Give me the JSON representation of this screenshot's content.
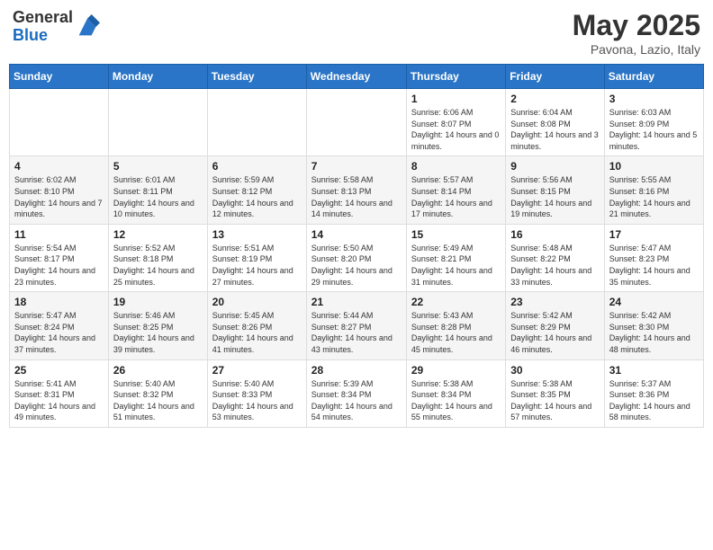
{
  "logo": {
    "general": "General",
    "blue": "Blue"
  },
  "header": {
    "month_title": "May 2025",
    "location": "Pavona, Lazio, Italy"
  },
  "weekdays": [
    "Sunday",
    "Monday",
    "Tuesday",
    "Wednesday",
    "Thursday",
    "Friday",
    "Saturday"
  ],
  "weeks": [
    [
      {
        "day": "",
        "info": ""
      },
      {
        "day": "",
        "info": ""
      },
      {
        "day": "",
        "info": ""
      },
      {
        "day": "",
        "info": ""
      },
      {
        "day": "1",
        "info": "Sunrise: 6:06 AM\nSunset: 8:07 PM\nDaylight: 14 hours and 0 minutes."
      },
      {
        "day": "2",
        "info": "Sunrise: 6:04 AM\nSunset: 8:08 PM\nDaylight: 14 hours and 3 minutes."
      },
      {
        "day": "3",
        "info": "Sunrise: 6:03 AM\nSunset: 8:09 PM\nDaylight: 14 hours and 5 minutes."
      }
    ],
    [
      {
        "day": "4",
        "info": "Sunrise: 6:02 AM\nSunset: 8:10 PM\nDaylight: 14 hours and 7 minutes."
      },
      {
        "day": "5",
        "info": "Sunrise: 6:01 AM\nSunset: 8:11 PM\nDaylight: 14 hours and 10 minutes."
      },
      {
        "day": "6",
        "info": "Sunrise: 5:59 AM\nSunset: 8:12 PM\nDaylight: 14 hours and 12 minutes."
      },
      {
        "day": "7",
        "info": "Sunrise: 5:58 AM\nSunset: 8:13 PM\nDaylight: 14 hours and 14 minutes."
      },
      {
        "day": "8",
        "info": "Sunrise: 5:57 AM\nSunset: 8:14 PM\nDaylight: 14 hours and 17 minutes."
      },
      {
        "day": "9",
        "info": "Sunrise: 5:56 AM\nSunset: 8:15 PM\nDaylight: 14 hours and 19 minutes."
      },
      {
        "day": "10",
        "info": "Sunrise: 5:55 AM\nSunset: 8:16 PM\nDaylight: 14 hours and 21 minutes."
      }
    ],
    [
      {
        "day": "11",
        "info": "Sunrise: 5:54 AM\nSunset: 8:17 PM\nDaylight: 14 hours and 23 minutes."
      },
      {
        "day": "12",
        "info": "Sunrise: 5:52 AM\nSunset: 8:18 PM\nDaylight: 14 hours and 25 minutes."
      },
      {
        "day": "13",
        "info": "Sunrise: 5:51 AM\nSunset: 8:19 PM\nDaylight: 14 hours and 27 minutes."
      },
      {
        "day": "14",
        "info": "Sunrise: 5:50 AM\nSunset: 8:20 PM\nDaylight: 14 hours and 29 minutes."
      },
      {
        "day": "15",
        "info": "Sunrise: 5:49 AM\nSunset: 8:21 PM\nDaylight: 14 hours and 31 minutes."
      },
      {
        "day": "16",
        "info": "Sunrise: 5:48 AM\nSunset: 8:22 PM\nDaylight: 14 hours and 33 minutes."
      },
      {
        "day": "17",
        "info": "Sunrise: 5:47 AM\nSunset: 8:23 PM\nDaylight: 14 hours and 35 minutes."
      }
    ],
    [
      {
        "day": "18",
        "info": "Sunrise: 5:47 AM\nSunset: 8:24 PM\nDaylight: 14 hours and 37 minutes."
      },
      {
        "day": "19",
        "info": "Sunrise: 5:46 AM\nSunset: 8:25 PM\nDaylight: 14 hours and 39 minutes."
      },
      {
        "day": "20",
        "info": "Sunrise: 5:45 AM\nSunset: 8:26 PM\nDaylight: 14 hours and 41 minutes."
      },
      {
        "day": "21",
        "info": "Sunrise: 5:44 AM\nSunset: 8:27 PM\nDaylight: 14 hours and 43 minutes."
      },
      {
        "day": "22",
        "info": "Sunrise: 5:43 AM\nSunset: 8:28 PM\nDaylight: 14 hours and 45 minutes."
      },
      {
        "day": "23",
        "info": "Sunrise: 5:42 AM\nSunset: 8:29 PM\nDaylight: 14 hours and 46 minutes."
      },
      {
        "day": "24",
        "info": "Sunrise: 5:42 AM\nSunset: 8:30 PM\nDaylight: 14 hours and 48 minutes."
      }
    ],
    [
      {
        "day": "25",
        "info": "Sunrise: 5:41 AM\nSunset: 8:31 PM\nDaylight: 14 hours and 49 minutes."
      },
      {
        "day": "26",
        "info": "Sunrise: 5:40 AM\nSunset: 8:32 PM\nDaylight: 14 hours and 51 minutes."
      },
      {
        "day": "27",
        "info": "Sunrise: 5:40 AM\nSunset: 8:33 PM\nDaylight: 14 hours and 53 minutes."
      },
      {
        "day": "28",
        "info": "Sunrise: 5:39 AM\nSunset: 8:34 PM\nDaylight: 14 hours and 54 minutes."
      },
      {
        "day": "29",
        "info": "Sunrise: 5:38 AM\nSunset: 8:34 PM\nDaylight: 14 hours and 55 minutes."
      },
      {
        "day": "30",
        "info": "Sunrise: 5:38 AM\nSunset: 8:35 PM\nDaylight: 14 hours and 57 minutes."
      },
      {
        "day": "31",
        "info": "Sunrise: 5:37 AM\nSunset: 8:36 PM\nDaylight: 14 hours and 58 minutes."
      }
    ]
  ]
}
